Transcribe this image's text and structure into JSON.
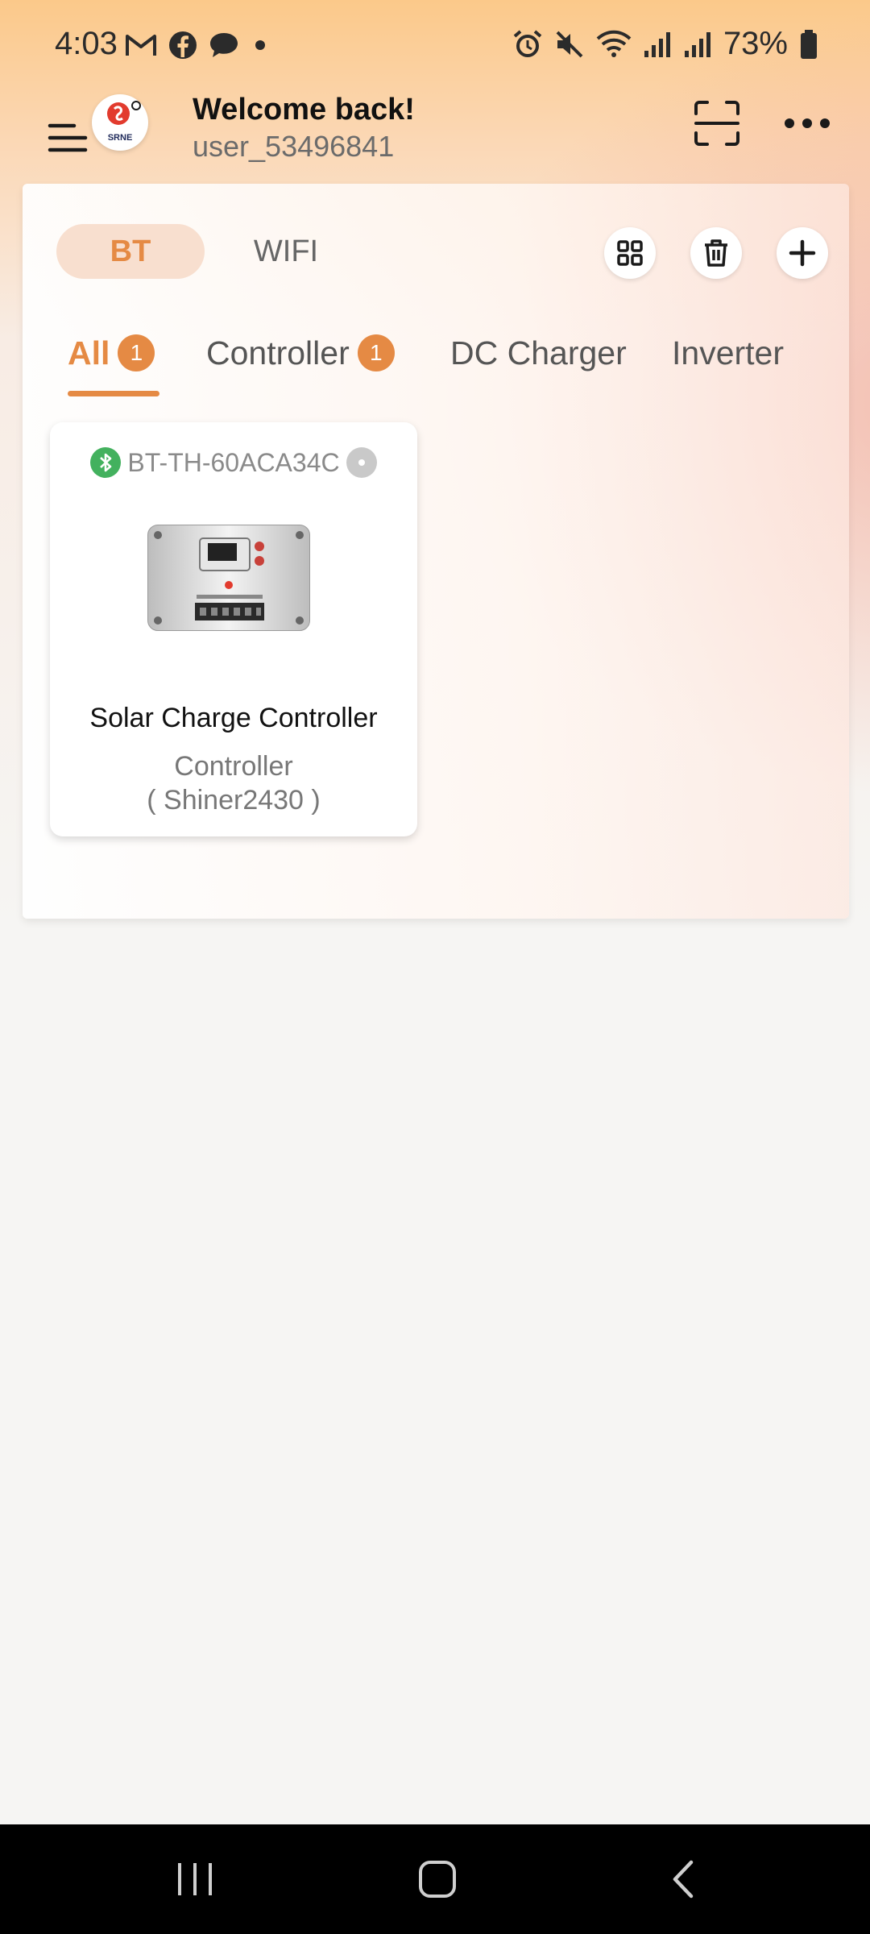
{
  "status_bar": {
    "time": "4:03",
    "battery": "73%",
    "left_icons": [
      "gmail-icon",
      "facebook-icon",
      "chat-icon",
      "dot-icon"
    ],
    "right_icons": [
      "alarm-icon",
      "mute-icon",
      "wifi-icon",
      "signal-icon",
      "signal-icon",
      "battery-icon"
    ]
  },
  "header": {
    "title": "Welcome back!",
    "username": "user_53496841",
    "logo_text": "SRNE"
  },
  "mode_toggle": {
    "bt_label": "BT",
    "wifi_label": "WIFI"
  },
  "category_tabs": [
    {
      "label": "All",
      "badge": "1",
      "active": true
    },
    {
      "label": "Controller",
      "badge": "1",
      "active": false
    },
    {
      "label": "DC Charger",
      "active": false
    },
    {
      "label": "Inverter",
      "active": false
    }
  ],
  "device": {
    "id": "BT-TH-60ACA34C",
    "name": "Solar Charge Controller",
    "type": "Controller",
    "model": "( Shiner2430 )"
  },
  "colors": {
    "accent": "#e58a44",
    "bt_green": "#43b15e"
  }
}
